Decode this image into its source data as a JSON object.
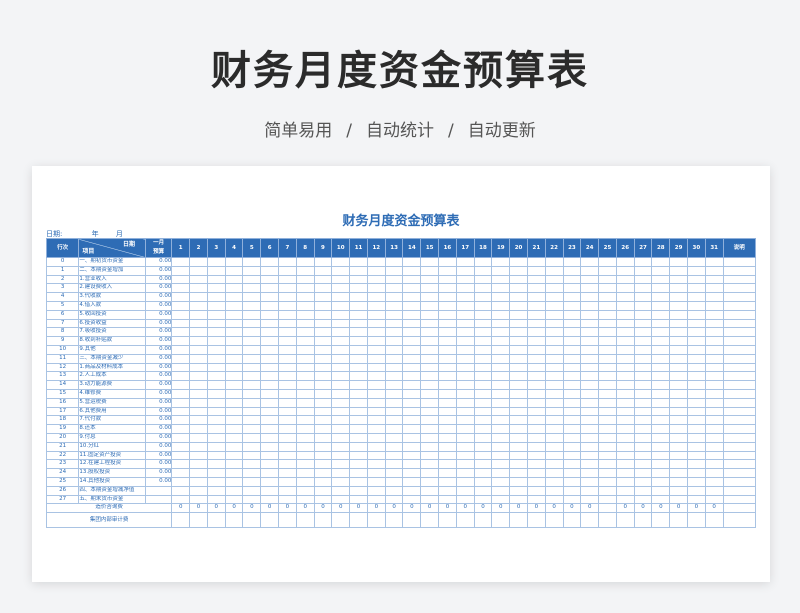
{
  "hero": {
    "title": "财务月度资金预算表",
    "tag1": "简单易用",
    "tag2": "自动统计",
    "tag3": "自动更新",
    "sep": "/"
  },
  "sheet": {
    "title": "财务月度资金预算表",
    "date_label": "日期:",
    "year_label": "年",
    "month_label": "月",
    "header": {
      "row_no": "行次",
      "date": "日期",
      "item": "项目",
      "budget_line1": "一月",
      "budget_line2": "预算",
      "note": "说明",
      "days": [
        "1",
        "2",
        "3",
        "4",
        "5",
        "6",
        "7",
        "8",
        "9",
        "10",
        "11",
        "12",
        "13",
        "14",
        "15",
        "16",
        "17",
        "18",
        "19",
        "20",
        "21",
        "22",
        "23",
        "24",
        "25",
        "26",
        "27",
        "28",
        "29",
        "30",
        "31"
      ]
    },
    "rows": [
      {
        "no": "0",
        "item": "一、期初货币资金",
        "budget": "0.00"
      },
      {
        "no": "1",
        "item": "二、本期资金增加",
        "budget": "0.00"
      },
      {
        "no": "2",
        "item": "1.营业收入",
        "budget": "0.00"
      },
      {
        "no": "3",
        "item": "2.建设费收入",
        "budget": "0.00"
      },
      {
        "no": "4",
        "item": "3.代收款",
        "budget": "0.00"
      },
      {
        "no": "5",
        "item": "4.借入款",
        "budget": "0.00"
      },
      {
        "no": "6",
        "item": "5.收回投资",
        "budget": "0.00"
      },
      {
        "no": "7",
        "item": "6.投资收益",
        "budget": "0.00"
      },
      {
        "no": "8",
        "item": "7.吸收投资",
        "budget": "0.00"
      },
      {
        "no": "9",
        "item": "8.收到补贴款",
        "budget": "0.00"
      },
      {
        "no": "10",
        "item": "9.其他",
        "budget": "0.00"
      },
      {
        "no": "11",
        "item": "三、本期资金减少",
        "budget": "0.00"
      },
      {
        "no": "12",
        "item": "1.商品及材料成本",
        "budget": "0.00"
      },
      {
        "no": "13",
        "item": "2.人工成本",
        "budget": "0.00"
      },
      {
        "no": "14",
        "item": "3.动力能源费",
        "budget": "0.00"
      },
      {
        "no": "15",
        "item": "4.维修费",
        "budget": "0.00"
      },
      {
        "no": "16",
        "item": "5.营运税费",
        "budget": "0.00"
      },
      {
        "no": "17",
        "item": "6.其他费用",
        "budget": "0.00"
      },
      {
        "no": "18",
        "item": "7.代付款",
        "budget": "0.00"
      },
      {
        "no": "19",
        "item": "8.还本",
        "budget": "0.00"
      },
      {
        "no": "20",
        "item": "9.付息",
        "budget": "0.00"
      },
      {
        "no": "21",
        "item": "10.分红",
        "budget": "0.00"
      },
      {
        "no": "22",
        "item": "11.固定资产投资",
        "budget": "0.00"
      },
      {
        "no": "23",
        "item": "12.在建工程投资",
        "budget": "0.00"
      },
      {
        "no": "24",
        "item": "13.股权投资",
        "budget": "0.00"
      },
      {
        "no": "25",
        "item": "14.其他投资",
        "budget": "0.00"
      },
      {
        "no": "26",
        "item": "四、本期资金增减净值",
        "budget": ""
      },
      {
        "no": "27",
        "item": "五、期末货币资金",
        "budget": ""
      }
    ],
    "footer": [
      {
        "label": "造价咨询费",
        "zeros": [
          "0",
          "0",
          "0",
          "0",
          "0",
          "0",
          "0",
          "0",
          "0",
          "0",
          "0",
          "0",
          "0",
          "0",
          "0",
          "0",
          "0",
          "0",
          "0",
          "0",
          "0",
          "0",
          "0",
          "0",
          "",
          "0",
          "0",
          "0",
          "0",
          "0",
          "0",
          "0"
        ]
      },
      {
        "label": "集团内部审计费"
      }
    ]
  }
}
